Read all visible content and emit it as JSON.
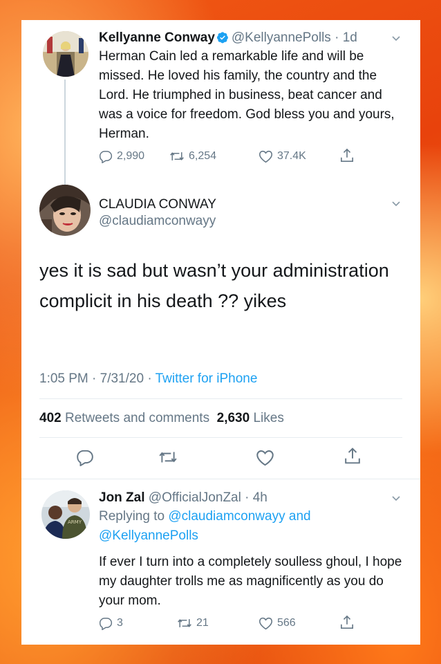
{
  "tweet1": {
    "name": "Kellyanne Conway",
    "handle": "@KellyannePolls",
    "time": "· 1d",
    "text": "Herman Cain led a remarkable life and will be missed. He loved his family, the country and the Lord. He triumphed in business, beat cancer and was a voice for freedom. God bless you and yours, Herman.",
    "replies": "2,990",
    "retweets": "6,254",
    "likes": "37.4K"
  },
  "tweet2": {
    "name": "CLAUDIA CONWAY",
    "handle": "@claudiamconwayy",
    "text": "yes it is sad but wasn’t your administration complicit in his death ?? yikes",
    "time_date": "1:05 PM · 7/31/20 · ",
    "source": "Twitter for iPhone",
    "retweets_count": "402",
    "retweets_label": "Retweets and comments",
    "likes_count": "2,630",
    "likes_label": "Likes"
  },
  "tweet3": {
    "name": "Jon Zal",
    "handle": "@OfficialJonZal",
    "time": "· 4h",
    "replying_prefix": "Replying to",
    "reply_to_1": "@claudiamconwayy",
    "reply_and": "and",
    "reply_to_2": "@KellyannePolls",
    "text": "If ever I turn into a completely soulless ghoul, I hope my daughter trolls me as magnificently as you do your mom.",
    "replies": "3",
    "retweets": "21",
    "likes": "566",
    "avatar_shirt_text": "ARMY"
  },
  "colors": {
    "accent": "#1da1f2",
    "secondary_text": "#657786",
    "primary_text": "#14171a",
    "divider": "#e6ecf0"
  },
  "icons": [
    "reply-icon",
    "retweet-icon",
    "like-icon",
    "share-icon",
    "verified-badge-icon",
    "chevron-down-icon"
  ]
}
